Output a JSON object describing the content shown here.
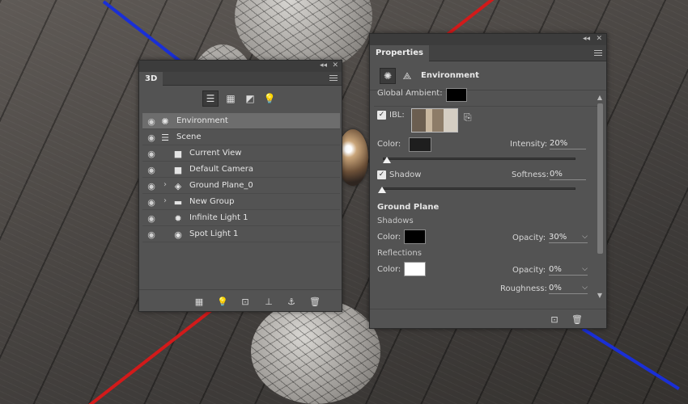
{
  "panel3d": {
    "tab_label": "3D",
    "close_glyph": "✕",
    "collapse_glyph": "◂◂",
    "filters": [
      {
        "name": "whole-scene",
        "glyph": "☰"
      },
      {
        "name": "meshes",
        "glyph": "▦"
      },
      {
        "name": "materials",
        "glyph": "◩"
      },
      {
        "name": "lights",
        "glyph": "💡"
      }
    ],
    "layers": [
      {
        "label": "Environment",
        "icon": "environment-icon",
        "glyph": "✺",
        "selected": true,
        "twirl": false
      },
      {
        "label": "Scene",
        "icon": "scene-icon",
        "glyph": "☰",
        "selected": false,
        "twirl": false
      },
      {
        "label": "Current View",
        "icon": "camera-icon",
        "glyph": "■",
        "selected": false,
        "twirl": false
      },
      {
        "label": "Default Camera",
        "icon": "camera-icon",
        "glyph": "■",
        "selected": false,
        "twirl": false
      },
      {
        "label": "Ground Plane_0",
        "icon": "mesh-icon",
        "glyph": "◈",
        "selected": false,
        "twirl": true
      },
      {
        "label": "New Group",
        "icon": "folder-icon",
        "glyph": "▬",
        "selected": false,
        "twirl": true
      },
      {
        "label": "Infinite Light 1",
        "icon": "infinite-light-icon",
        "glyph": "✹",
        "selected": false,
        "twirl": false
      },
      {
        "label": "Spot Light 1",
        "icon": "spot-light-icon",
        "glyph": "◉",
        "selected": false,
        "twirl": false
      }
    ],
    "bottom_icons": [
      "▦",
      "💡",
      "⊡",
      "⊥",
      "⚓",
      "🗑"
    ]
  },
  "properties": {
    "tab_label": "Properties",
    "close_glyph": "✕",
    "collapse_glyph": "◂◂",
    "section_title": "Environment",
    "global_ambient_label": "Global Ambient:",
    "global_ambient_color": "#000000",
    "ibl_label": "IBL:",
    "ibl_checked": true,
    "color_label": "Color:",
    "ibl_color": "#1e1e1e",
    "intensity_label": "Intensity:",
    "intensity_value": "20%",
    "intensity_fraction": 0.02,
    "shadow_label": "Shadow",
    "shadow_checked": true,
    "softness_label": "Softness:",
    "softness_value": "0%",
    "ground_plane_heading": "Ground Plane",
    "shadows_label": "Shadows",
    "shadows_color_label": "Color:",
    "shadows_color": "#000000",
    "shadows_opacity_label": "Opacity:",
    "shadows_opacity_value": "30%",
    "reflections_label": "Reflections",
    "reflections_color_label": "Color:",
    "reflections_color": "#ffffff",
    "reflections_opacity_label": "Opacity:",
    "reflections_opacity_value": "0%",
    "roughness_label": "Roughness:",
    "roughness_value": "0%",
    "bottom_icons": [
      "⊡",
      "🗑"
    ]
  }
}
